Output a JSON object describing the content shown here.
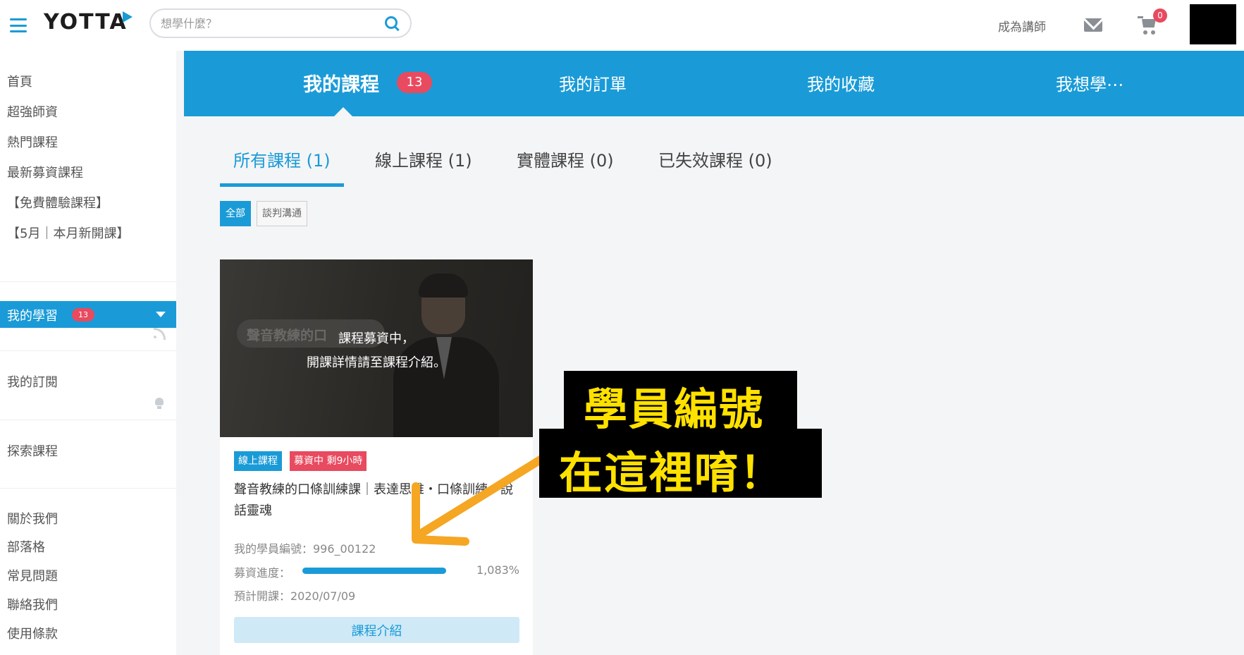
{
  "header": {
    "logo": "YOTTA",
    "search_placeholder": "想學什麼？",
    "become_teacher": "成為講師",
    "cart_count": "0"
  },
  "sidebar": {
    "items": [
      "首頁",
      "超強師資",
      "熱門課程",
      "最新募資課程",
      "【免費體驗課程】",
      "【5月｜本月新開課】"
    ],
    "my_learning": "我的學習",
    "my_learning_count": "13",
    "subscription": "我的訂閱",
    "explore": "探索課程",
    "footer_items": [
      "關於我們",
      "部落格",
      "常見問題",
      "聯絡我們",
      "使用條款"
    ]
  },
  "top_tabs": {
    "my_courses": "我的課程",
    "my_courses_count": "13",
    "my_orders": "我的訂單",
    "my_favorites": "我的收藏",
    "wishlist": "我想學⋯"
  },
  "sub_tabs": {
    "all": "所有課程 (1)",
    "online": "線上課程 (1)",
    "physical": "實體課程 (0)",
    "expired": "已失效課程 (0)"
  },
  "filters": {
    "all": "全部",
    "negotiation": "談判溝通"
  },
  "card": {
    "image_text": "聲音教練的口",
    "overlay_line1": "課程募資中，",
    "overlay_line2": "開課詳情請至課程介紹。",
    "tag_online": "線上課程",
    "tag_raising": "募資中 剩9小時",
    "title": "聲音教練的口條訓練課｜表達思維・口條訓練・說話靈魂",
    "student_id": "我的學員編號：996_00122",
    "progress_label": "募資進度：",
    "progress_value": "1,083%",
    "progress_fraction": 1.0,
    "expected_open": "預計開課：2020/07/09",
    "intro_button": "課程介紹"
  },
  "annotation": {
    "line1": "學員編號",
    "line2": "在這裡唷！"
  },
  "colors": {
    "brand": "#1a9bd7",
    "badge": "#e84a5f",
    "annotation_text": "#ffe100",
    "arrow": "#f5a623"
  }
}
